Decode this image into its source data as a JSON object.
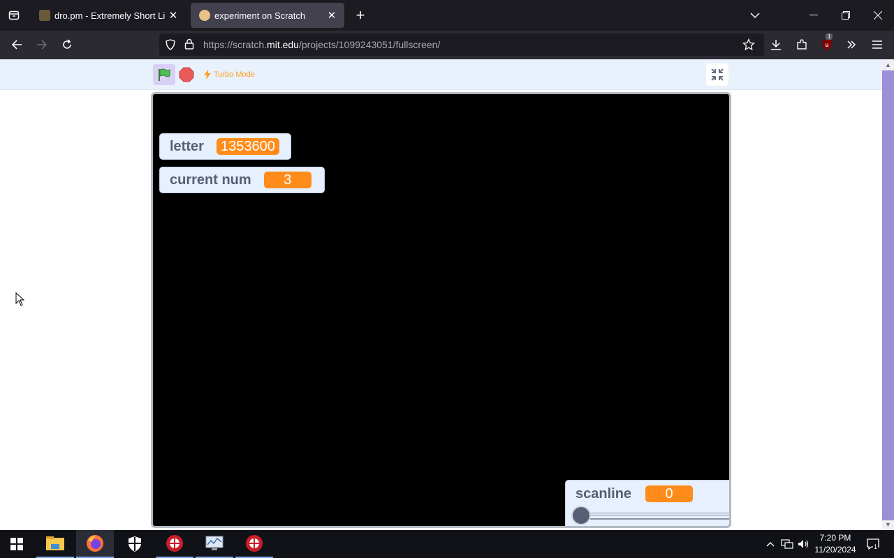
{
  "browser": {
    "tabs": [
      {
        "title": "dro.pm - Extremely Short Links",
        "active": false
      },
      {
        "title": "experiment on Scratch",
        "active": true
      }
    ],
    "url": {
      "prefix": "https://scratch.",
      "host": "mit.edu",
      "path": "/projects/1099243051/fullscreen/"
    },
    "extension_badge": "1"
  },
  "scratch": {
    "turbo_label": "Turbo Mode",
    "monitors": {
      "letter": {
        "label": "letter",
        "value": "1353600"
      },
      "current_num": {
        "label": "current num",
        "value": "3"
      },
      "scanline": {
        "label": "scanline",
        "value": "0",
        "slider_fraction": 0
      }
    },
    "colors": {
      "accent": "#ff8c1a",
      "monitor_bg": "#e6f0ff",
      "label": "#575e75"
    }
  },
  "taskbar": {
    "apps": [
      "start-icon",
      "file-explorer-icon",
      "firefox-icon",
      "defender-icon",
      "app-red-icon",
      "monitor-app-icon",
      "app-red-icon"
    ],
    "clock_time": "7:20 PM",
    "clock_date": "11/20/2024",
    "notification_count": "1"
  }
}
